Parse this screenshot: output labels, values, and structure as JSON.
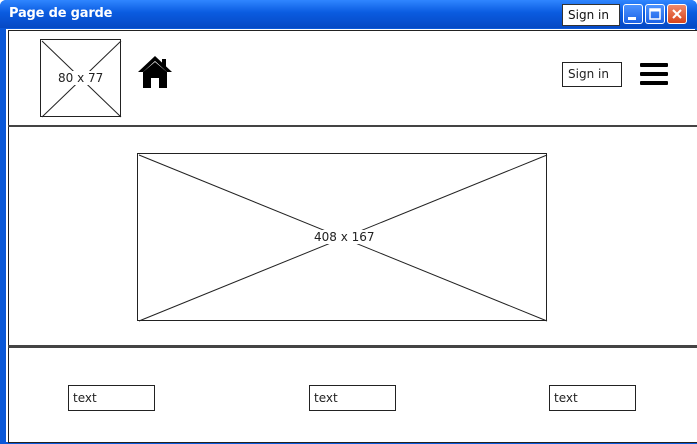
{
  "window": {
    "title": "Page de garde",
    "titlebar_signin": "Sign in",
    "controls": [
      "minimize-icon",
      "maximize-icon",
      "close-icon"
    ],
    "colors": {
      "titlebar": "#0a5be0",
      "close": "#d8431c"
    }
  },
  "header": {
    "logo_placeholder": "80 x 77",
    "home_icon": "home-icon",
    "signin_label": "Sign in",
    "menu_icon": "hamburger-menu-icon"
  },
  "hero": {
    "image_placeholder": "408 x 167"
  },
  "footer": {
    "fields": [
      "text",
      "text",
      "text"
    ]
  }
}
